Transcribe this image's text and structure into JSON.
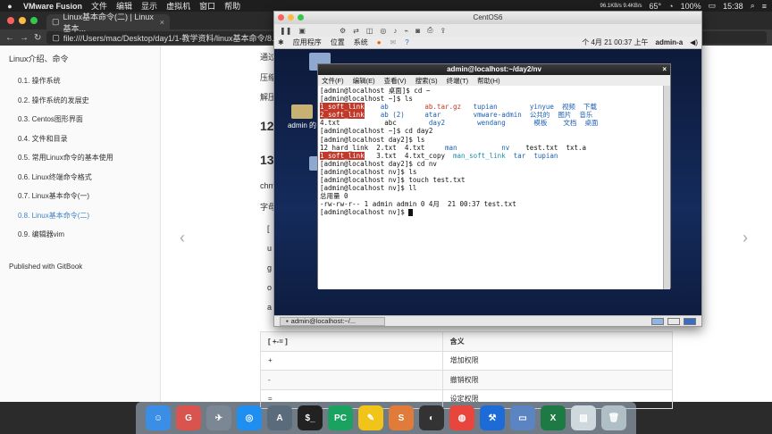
{
  "menubar": {
    "app": "VMware Fusion",
    "items": [
      "文件",
      "编辑",
      "显示",
      "虚拟机",
      "窗口",
      "帮助"
    ],
    "net": "96.1KB/s 9.4KB/s",
    "temp": "65°",
    "battery": "100%",
    "time": "15:38"
  },
  "browser": {
    "tab_title": "Linux基本命令(二) | Linux基本...",
    "url": "file:///Users/mac/Desktop/day1/1-教学资料/linux基本命令/8.h"
  },
  "sidebar": {
    "head": "Linux介绍、命令",
    "items": [
      {
        "label": "0.1. 操作系统"
      },
      {
        "label": "0.2. 操作系统的发展史"
      },
      {
        "label": "0.3. Centos图形界面"
      },
      {
        "label": "0.4. 文件和目录"
      },
      {
        "label": "0.5. 常用Linux命令的基本使用"
      },
      {
        "label": "0.6. Linux终端命令格式"
      },
      {
        "label": "0.7. Linux基本命令(一)"
      },
      {
        "label": "0.8. Linux基本命令(二)"
      },
      {
        "label": "0.9. 编辑器vim"
      }
    ],
    "published": "Published with GitBook"
  },
  "content": {
    "frag1": "通过",
    "frag2": "压缩",
    "frag3": "解压",
    "h12": "12",
    "h13": "13",
    "frag4": "chm",
    "frag5": "字母",
    "col_a": [
      "[",
      "u",
      "g",
      "o",
      "a"
    ],
    "table": {
      "header": [
        "[ +-= ]",
        "含义"
      ],
      "rows": [
        [
          "+",
          "增加权限"
        ],
        [
          "-",
          "撤销权限"
        ],
        [
          "=",
          "设定权限"
        ]
      ]
    }
  },
  "vmware": {
    "title": "CentOS6",
    "gnome_menu": [
      "应用程序",
      "位置",
      "系统"
    ],
    "datetime": "个 4月 21 00:37 上午",
    "user": "admin-a",
    "desktop_icons": [
      "",
      "admin 的",
      ""
    ],
    "terminal": {
      "title": "admin@localhost:~/day2/nv",
      "menu": [
        "文件(F)",
        "编辑(E)",
        "查看(V)",
        "搜索(S)",
        "终端(T)",
        "帮助(H)"
      ]
    },
    "taskbar_item": "admin@localhost:~/..."
  },
  "dock": [
    "Finder",
    "GitKraken",
    "Launchpad",
    "Safari",
    "Atom",
    "Terminal",
    "PyCharm",
    "TextEdit",
    "Sublime",
    "Fusion",
    "Chrome",
    "Xcode",
    "VMware",
    "Excel",
    "Preview",
    "Trash"
  ],
  "colors": {
    "link": "#4183c4",
    "term_blue": "#1e5fb3",
    "term_red": "#c0392b"
  }
}
